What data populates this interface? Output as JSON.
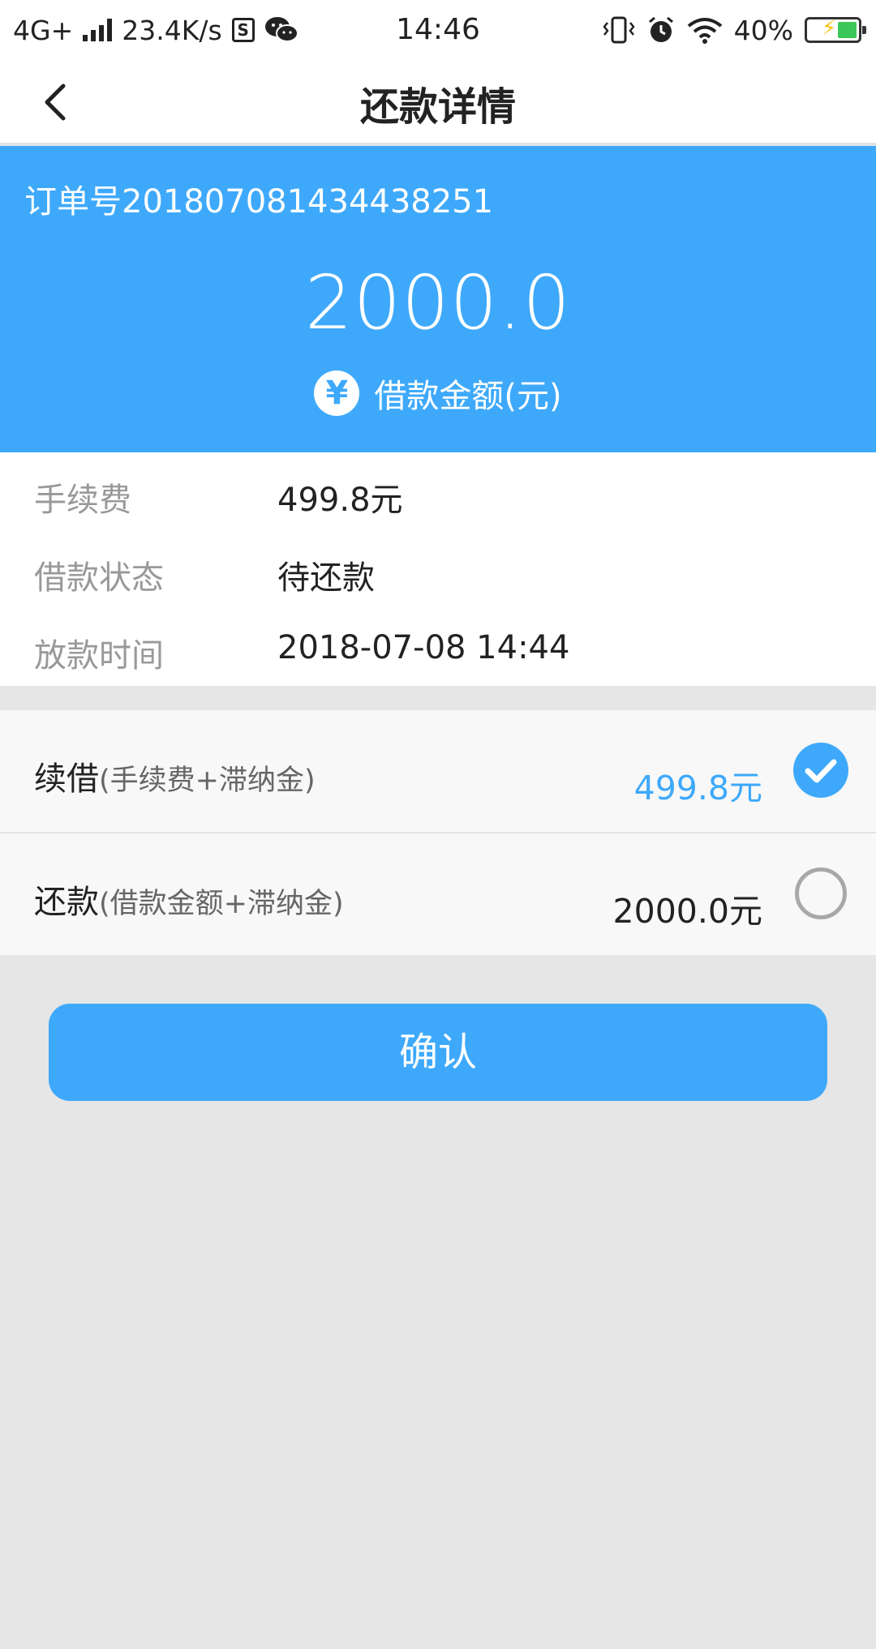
{
  "status_bar": {
    "network": "4G+",
    "speed": "23.4K/s",
    "time": "14:46",
    "battery": "40%",
    "battery_level": 0.4
  },
  "nav": {
    "title": "还款详情"
  },
  "hero": {
    "order_number": "订单号20180708143443825​1",
    "amount": "2000.0",
    "currency_symbol": "¥",
    "amount_label": "借款金额(元)"
  },
  "info": {
    "rows": [
      {
        "label": "手续费",
        "value": "499.8元"
      },
      {
        "label": "借款状态",
        "value": "待还款"
      },
      {
        "label": "放款时间",
        "value": "2018-07-08 14:44"
      }
    ]
  },
  "options": [
    {
      "title": "续借",
      "subtitle": "(手续费+滞纳金)",
      "amount": "499.8元",
      "selected": true,
      "amount_color": "#3ea9fb"
    },
    {
      "title": "还款",
      "subtitle": "(借款金额+滞纳金)",
      "amount": "2000.0元",
      "selected": false,
      "amount_color": "#222222"
    }
  ],
  "confirm": {
    "label": "确认"
  },
  "colors": {
    "accent": "#3ea9fb",
    "background": "#e6e6e6"
  }
}
